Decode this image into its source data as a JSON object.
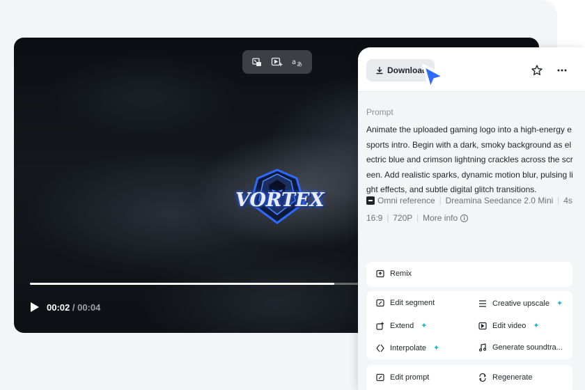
{
  "player": {
    "current_time": "00:02",
    "duration": "/ 00:04",
    "progress_fraction": 0.91,
    "logo_text": "VORTEX"
  },
  "panel": {
    "download_label": "Download",
    "prompt_label": "Prompt",
    "prompt_text": "Animate the uploaded gaming logo into a high-energy esports intro. Begin with a dark, smoky background as electric blue and crimson lightning crackles across the screen. Add realistic sparks, dynamic motion blur, pulsing light effects, and subtle digital glitch transitions.",
    "meta": {
      "reference": "Omni reference",
      "model": "Dreamina Seedance 2.0 Mini",
      "duration": "4s",
      "ratio": "16:9",
      "resolution": "720P",
      "more_info": "More info"
    },
    "actions": {
      "remix": "Remix",
      "edit_segment": "Edit segment",
      "creative_upscale": "Creative upscale",
      "extend": "Extend",
      "edit_video": "Edit video",
      "interpolate": "Interpolate",
      "generate_soundtrack": "Generate soundtra...",
      "edit_prompt": "Edit prompt",
      "regenerate": "Regenerate"
    }
  },
  "colors": {
    "accent_cursor": "#2f6bff",
    "sparkle": "#1bb6c9"
  }
}
